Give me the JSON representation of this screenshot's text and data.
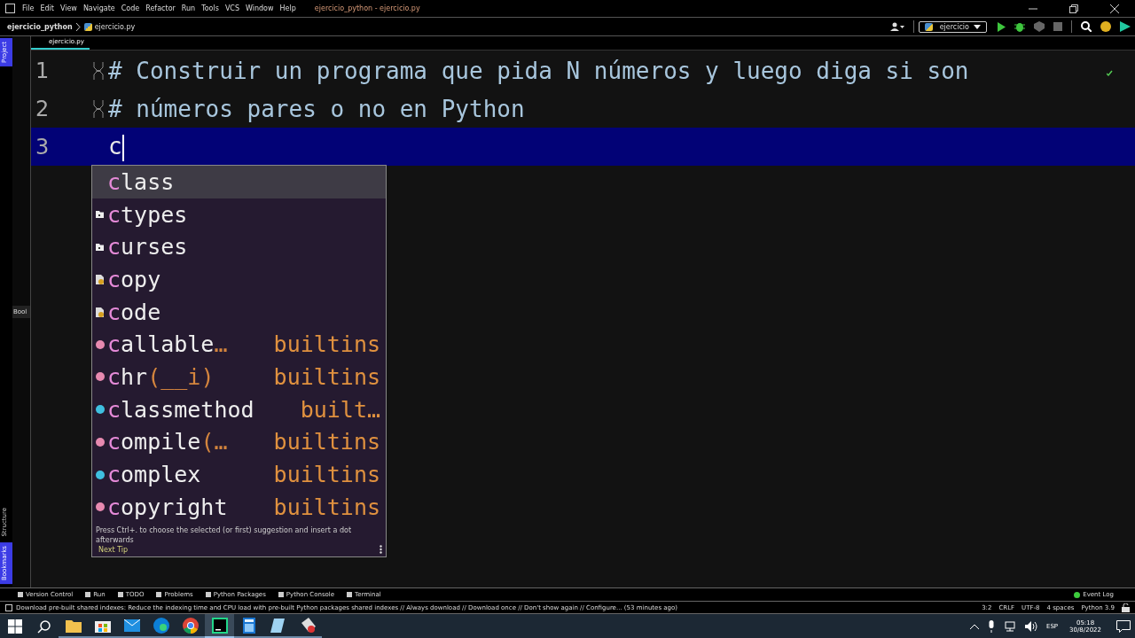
{
  "menu_bar": {
    "items": [
      "File",
      "Edit",
      "View",
      "Navigate",
      "Code",
      "Refactor",
      "Run",
      "Tools",
      "VCS",
      "Window",
      "Help"
    ],
    "title": "ejercicio_python - ejercicio.py"
  },
  "nav_bar": {
    "breadcrumbs": [
      "ejercicio_python",
      "ejercicio.py"
    ],
    "run_config": "ejercicio"
  },
  "left_strip": {
    "tabs": [
      {
        "label": "Project",
        "selected": true
      },
      {
        "label": "Structure",
        "selected": false
      },
      {
        "label": "Bookmarks",
        "selected": true
      }
    ]
  },
  "project_panel": {
    "tab": "Bool"
  },
  "editor_tabs": [
    {
      "label": "ejercicio.py",
      "selected": true
    }
  ],
  "editor": {
    "lines": [
      {
        "number": "1",
        "text": "# Construir un programa que pida N números y luego diga si son",
        "kind": "comment",
        "fold": true,
        "current": false
      },
      {
        "number": "2",
        "text": "# números pares o no en Python",
        "kind": "comment",
        "fold": true,
        "current": false
      },
      {
        "number": "3",
        "text": "c",
        "kind": "code",
        "fold": false,
        "current": true
      }
    ]
  },
  "completion": {
    "items": [
      {
        "kind": "keyword",
        "prefix": "c",
        "rest": "lass",
        "selected": true
      },
      {
        "kind": "package",
        "prefix": "c",
        "rest": "types",
        "selected": false
      },
      {
        "kind": "package",
        "prefix": "c",
        "rest": "urses",
        "selected": false
      },
      {
        "kind": "module",
        "prefix": "c",
        "rest": "opy",
        "selected": false
      },
      {
        "kind": "module",
        "prefix": "c",
        "rest": "ode",
        "selected": false
      },
      {
        "kind": "function",
        "prefix": "c",
        "rest": "allable",
        "params": "…",
        "source": "builtins",
        "selected": false
      },
      {
        "kind": "function",
        "prefix": "c",
        "rest": "hr",
        "params": "(__i)",
        "source": "builtins",
        "selected": false
      },
      {
        "kind": "class",
        "prefix": "c",
        "rest": "lassmethod",
        "source": "built…",
        "selected": false
      },
      {
        "kind": "function",
        "prefix": "c",
        "rest": "ompile",
        "params": "(…",
        "source": "builtins",
        "selected": false
      },
      {
        "kind": "class",
        "prefix": "c",
        "rest": "omplex",
        "source": "builtins",
        "selected": false
      },
      {
        "kind": "function",
        "prefix": "c",
        "rest": "opyright",
        "source": "builtins",
        "selected": false
      }
    ],
    "hint": "Press Ctrl+. to choose the selected (or first) suggestion and insert a dot afterwards",
    "next_tip": "Next Tip"
  },
  "tool_window_bar": {
    "items": [
      "Version Control",
      "Run",
      "TODO",
      "Problems",
      "Python Packages",
      "Python Console",
      "Terminal"
    ],
    "event_log": "Event Log"
  },
  "status_bar": {
    "message": "Download pre-built shared indexes: Reduce the indexing time and CPU load with pre-built Python packages shared indexes // Always download // Download once // Don't show again // Configure... (53 minutes ago)",
    "items": [
      "3:2",
      "CRLF",
      "UTF-8",
      "4 spaces",
      "Python 3.9"
    ]
  },
  "taskbar": {
    "apps": [
      {
        "selected": false
      },
      {
        "selected": false
      },
      {
        "selected": false
      },
      {
        "selected": false
      },
      {
        "selected": false
      },
      {
        "selected": true
      },
      {
        "selected": false
      },
      {
        "selected": false
      },
      {
        "selected": false
      }
    ],
    "language": "ESP",
    "time": "05:18",
    "date": "30/8/2022"
  }
}
